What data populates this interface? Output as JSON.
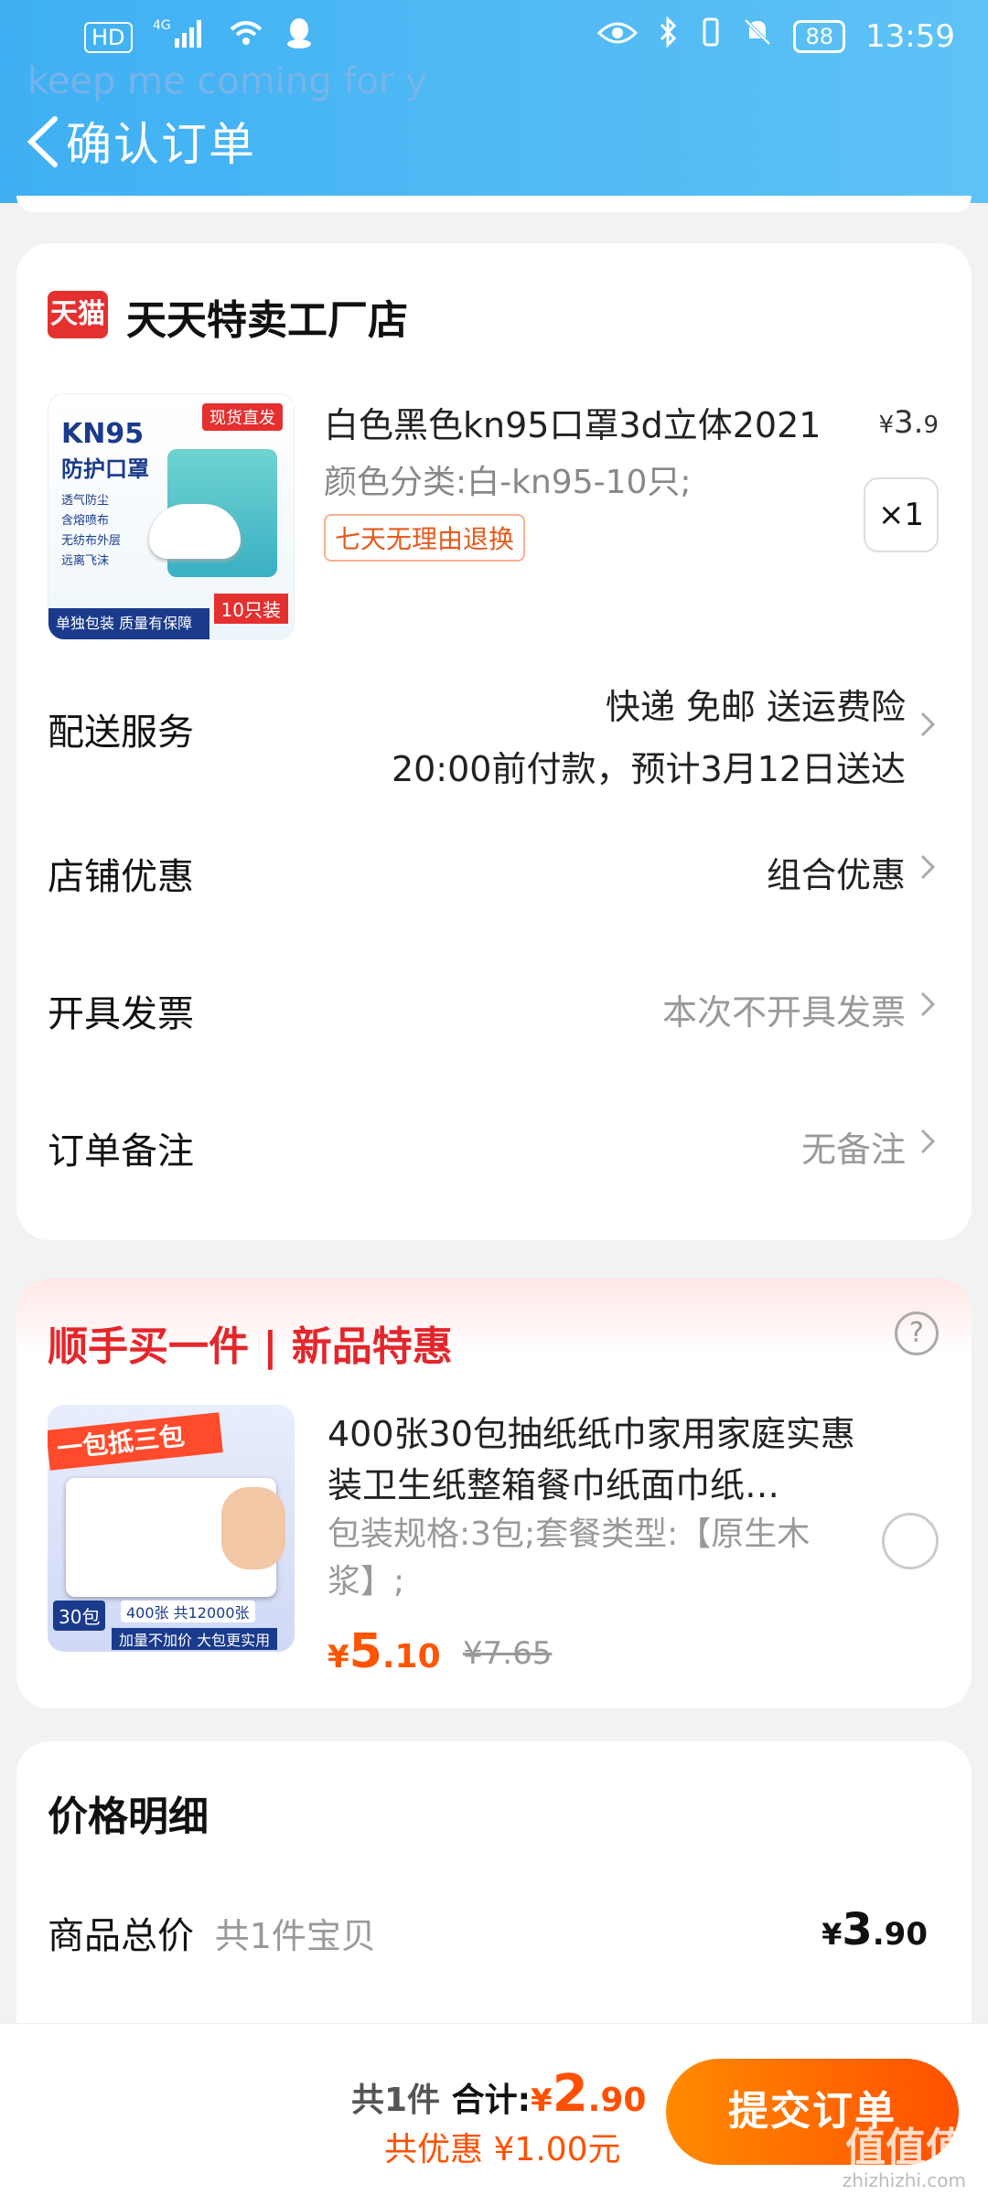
{
  "status_bar": {
    "left": [
      "HD",
      "4G",
      "WiFi",
      "QQ"
    ],
    "battery": "88",
    "time": "13:59"
  },
  "watermark_top": "keep me coming for y",
  "header": {
    "title": "确认订单"
  },
  "shop": {
    "logo": "天猫",
    "name": "天天特卖工厂店",
    "product": {
      "image_text": {
        "brand": "KN95",
        "subtitle": "防护口罩",
        "badge": "现货直发",
        "pack": "10只装",
        "footer": "单独包装 质量有保障",
        "features": [
          "透气防尘",
          "含熔喷布",
          "无纺布外层",
          "远离飞沫"
        ]
      },
      "title": "白色黑色kn95口罩3d立体2021",
      "price_symbol": "¥",
      "price_int": "3.",
      "price_dec": "9",
      "spec": "颜色分类:白-kn95-10只;",
      "tag": "七天无理由退换",
      "qty": "×1"
    },
    "rows": [
      {
        "label": "配送服务",
        "value_line1": "快递 免邮 送运费险",
        "value_line2": "20:00前付款，预计3月12日送达"
      },
      {
        "label": "店铺优惠",
        "value": "组合优惠"
      },
      {
        "label": "开具发票",
        "value": "本次不开具发票"
      },
      {
        "label": "订单备注",
        "value": "无备注"
      }
    ]
  },
  "combo": {
    "title": "顺手买一件 | 新品特惠",
    "help_icon": "?",
    "image_text": {
      "banner": "一包抵三包",
      "count": "400张 共12000张",
      "footer": "加量不加价 大包更实用",
      "pack": "30包"
    },
    "product_title": "400张30包抽纸纸巾家用家庭实惠装卫生纸整箱餐巾纸面巾纸…",
    "spec": "包装规格:3包;套餐类型:【原生木浆】;",
    "price_symbol": "¥",
    "price_int": "5",
    "price_dec": ".10",
    "orig_price": "¥7.65"
  },
  "price_detail": {
    "title": "价格明细",
    "rows": [
      {
        "label": "商品总价",
        "sub": "共1件宝贝",
        "price_symbol": "¥",
        "price_int": "3",
        "price_dec": ".90"
      }
    ]
  },
  "bottom_bar": {
    "count": "共1件",
    "total_label": "合计:",
    "total_symbol": "¥",
    "total_int": "2",
    "total_dec": ".90",
    "discount": "共优惠 ¥1.00元",
    "submit": "提交订单",
    "watermark": "值值值",
    "watermark_url": "zhizhizhi.com"
  },
  "colors": {
    "accent": "#ff5000",
    "header": "#3fb0f3",
    "red": "#e3262b"
  }
}
